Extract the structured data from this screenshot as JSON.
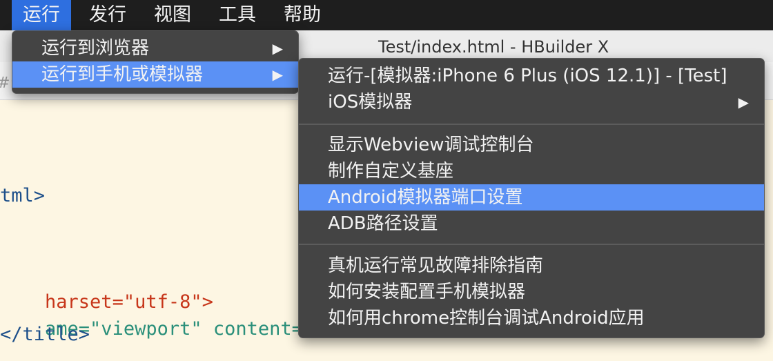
{
  "menubar": {
    "items": [
      {
        "label": "运行",
        "active": true
      },
      {
        "label": "发行"
      },
      {
        "label": "视图"
      },
      {
        "label": "工具"
      },
      {
        "label": "帮助"
      }
    ]
  },
  "window": {
    "title": "Test/index.html - HBuilder X",
    "toolbar_fragment": "#:"
  },
  "editor": {
    "lines": [
      "tml>",
      "harset=\"utf-8\">",
      "ame=\"viewport\" content=",
      "</title>"
    ]
  },
  "run_menu": {
    "items": [
      {
        "label": "运行到浏览器",
        "has_submenu": true
      },
      {
        "label": "运行到手机或模拟器",
        "has_submenu": true,
        "highlighted": true
      }
    ]
  },
  "device_menu": {
    "group1": [
      {
        "label": "运行-[模拟器:iPhone 6 Plus (iOS 12.1)] - [Test]"
      },
      {
        "label": "iOS模拟器",
        "has_submenu": true
      }
    ],
    "group2": [
      {
        "label": "显示Webview调试控制台"
      },
      {
        "label": "制作自定义基座"
      },
      {
        "label": "Android模拟器端口设置",
        "highlighted": true
      },
      {
        "label": "ADB路径设置"
      }
    ],
    "group3": [
      {
        "label": "真机运行常见故障排除指南"
      },
      {
        "label": "如何安装配置手机模拟器"
      },
      {
        "label": "如何用chrome控制台调试Android应用"
      }
    ]
  },
  "icons": {
    "submenu_arrow": "triangle-right-icon",
    "arrow_glyph": "▶"
  },
  "colors": {
    "menubar_bg": "#1e1e1e",
    "menu_bg": "#444444",
    "highlight": "#5b91f5",
    "editor_bg": "#fdf6e3"
  }
}
